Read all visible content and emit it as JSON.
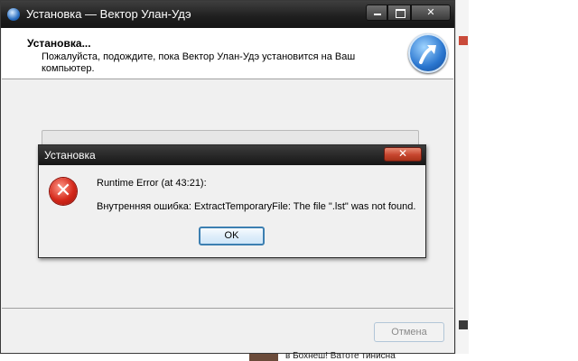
{
  "colors": {
    "titlebar": "#1e1e1e",
    "accent": "#2a76cf",
    "error": "#d4281a",
    "ok_border": "#3c7fb1"
  },
  "main_window": {
    "title": "Установка — Вектор Улан-Удэ",
    "app_icon": "installer-icon",
    "header_title": "Установка...",
    "header_subtitle": "Пожалуйста, подождите, пока Вектор Улан-Удэ установится на Ваш компьютер.",
    "logo_icon": "arrow-logo-icon",
    "cancel_label": "Отмена",
    "progress": 0
  },
  "error_dialog": {
    "title": "Установка",
    "icon": "error-icon",
    "message_line1": "Runtime Error (at 43:21):",
    "message_line2": "Внутренняя ошибка: ExtractTemporaryFile: The file \".lst\" was not found.",
    "ok_label": "OK"
  },
  "background": {
    "bottom_text": "в Бохнеш! Ватоте тинисна"
  }
}
